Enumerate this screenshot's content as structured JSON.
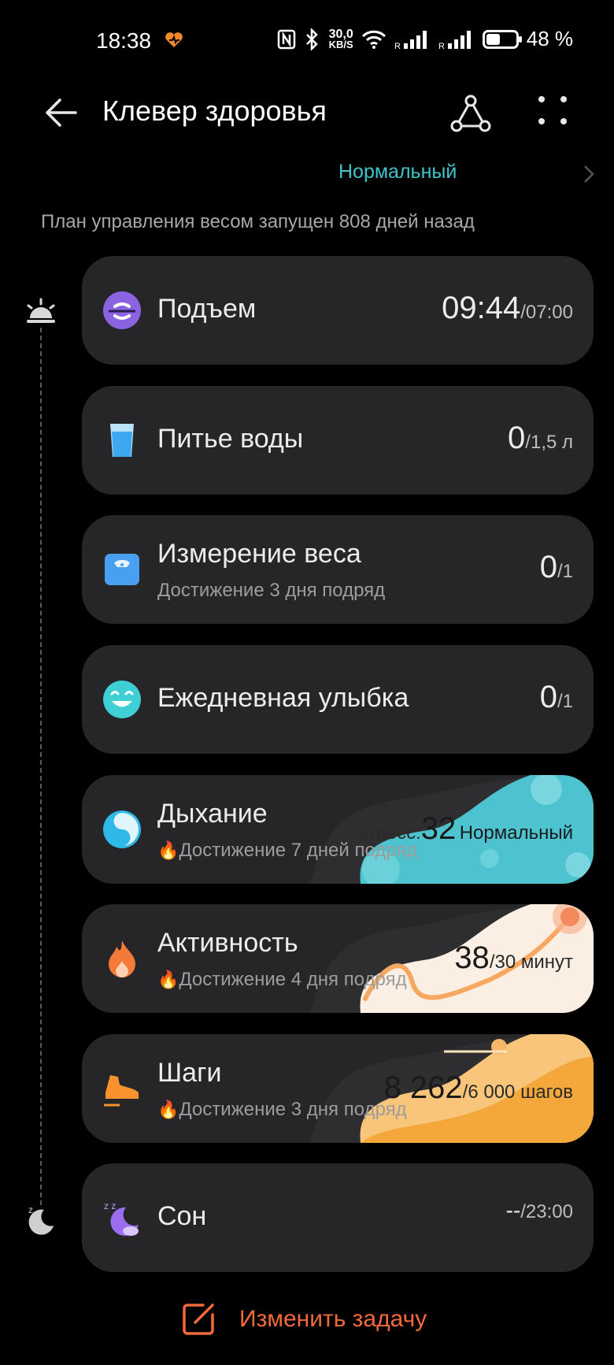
{
  "status_bar": {
    "time": "18:38",
    "speed_value": "30,0",
    "speed_unit": "KB/S",
    "battery": "48 %",
    "battery_level": 0.48,
    "icons": [
      "health-app-heart-icon",
      "nfc-icon",
      "bluetooth-icon",
      "wifi-icon",
      "signal-icon",
      "signal-icon",
      "battery-icon"
    ]
  },
  "header": {
    "title": "Клевер здоровья",
    "back_icon": "arrow-left-icon",
    "share_icon": "share-icon",
    "more_icon": "more-dots-icon"
  },
  "cut_off_status": "Нормальный",
  "plan_text": "План управления весом запущен 808 дней назад",
  "tasks": [
    {
      "name": "Подъем",
      "icon": "wake-up-icon",
      "value": "09:44",
      "target": "/07:00"
    },
    {
      "name": "Питье воды",
      "icon": "water-glass-icon",
      "value": "0",
      "target": "/1,5 л"
    },
    {
      "name": "Измерение веса",
      "icon": "scale-icon",
      "subtitle": "Достижение 3 дня подряд",
      "value": "0",
      "target": "/1"
    },
    {
      "name": "Ежедневная улыбка",
      "icon": "smile-icon",
      "value": "0",
      "target": "/1"
    },
    {
      "name": "Дыхание",
      "icon": "breathing-icon",
      "subtitle": "Достижение 7 дней подряд",
      "streak_icon": "flame-icon",
      "value_prefix": "Стресс:",
      "value": "32",
      "value_suffix": "Нормальный"
    },
    {
      "name": "Активность",
      "icon": "activity-flame-icon",
      "subtitle": "Достижение 4 дня подряд",
      "streak_icon": "flame-icon",
      "value": "38",
      "target": "/30 минут"
    },
    {
      "name": "Шаги",
      "icon": "sneaker-icon",
      "subtitle": "Достижение 3 дня подряд",
      "streak_icon": "flame-icon",
      "value": "8 262",
      "target": "/6 000 шагов"
    },
    {
      "name": "Сон",
      "icon": "sleep-moon-icon",
      "value": "--",
      "target": "/23:00"
    }
  ],
  "edit_task_label": "Изменить задачу",
  "colors": {
    "accent_teal": "#3fc4ca",
    "accent_orange": "#f26a39",
    "card_bg": "#262629"
  }
}
